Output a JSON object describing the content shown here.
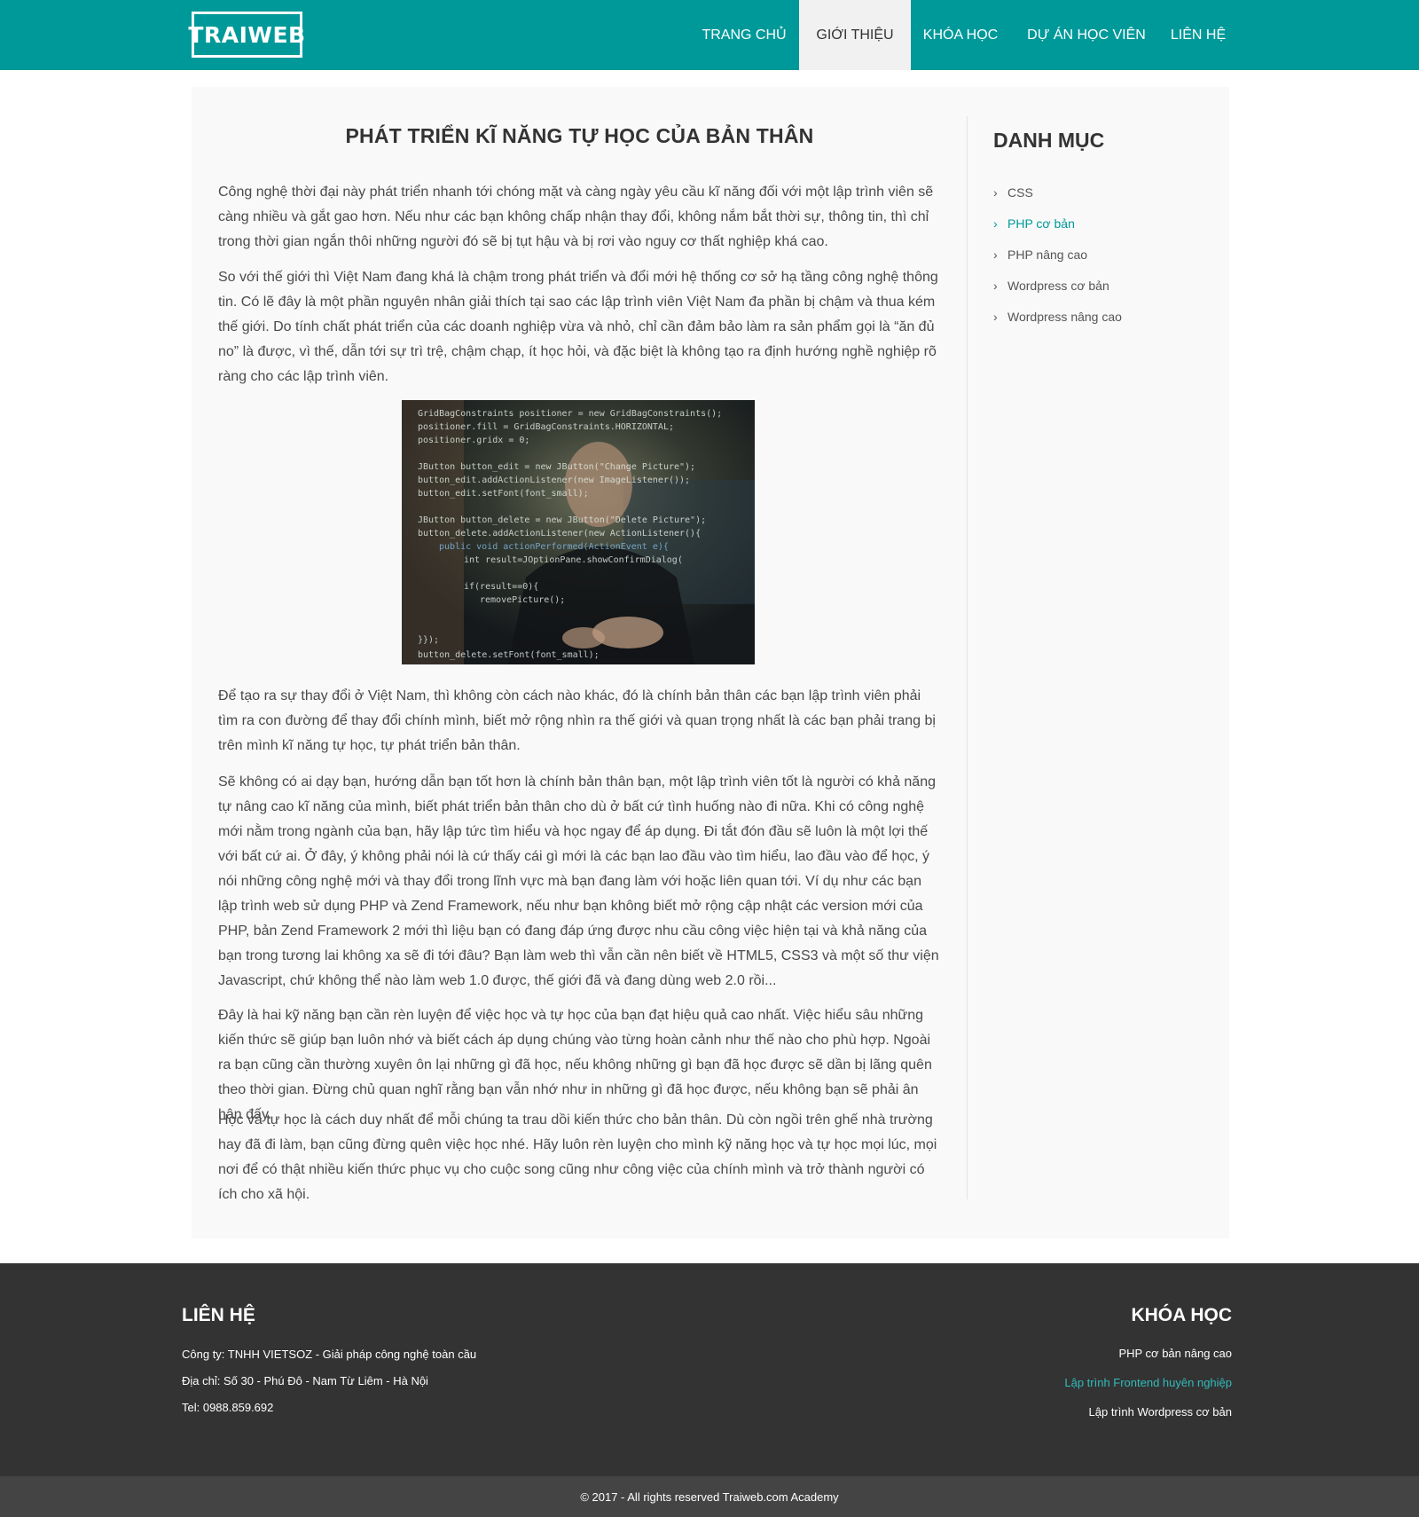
{
  "header": {
    "logo": "TRAIWEB",
    "nav": [
      {
        "label": "TRANG CHỦ"
      },
      {
        "label": "GIỚI THIỆU"
      },
      {
        "label": "KHÓA HỌC"
      },
      {
        "label": "DỰ ÁN HỌC VIÊN"
      },
      {
        "label": "LIÊN HỆ"
      }
    ]
  },
  "article": {
    "title": "PHÁT TRIỂN KĨ NĂNG TỰ HỌC CỦA BẢN THÂN",
    "paragraphs": [
      "Công nghệ thời đại này phát triển nhanh tới chóng mặt và càng ngày yêu cầu kĩ năng đối với một lập trình viên sẽ càng nhiều và gắt gao hơn. Nếu như các bạn không chấp nhận thay đổi, không nắm bắt thời sự, thông tin, thì chỉ trong thời gian ngắn thôi những người đó sẽ bị tụt hậu và bị rơi vào nguy cơ thất nghiệp khá cao.",
      "So với thế giới thì Việt Nam đang khá là chậm trong phát triển và đổi mới hệ thống cơ sở hạ tầng công nghệ thông tin. Có lẽ đây là một phần nguyên nhân giải thích tại sao các lập trình viên Việt Nam đa phần bị chậm và thua kém thế giới. Do tính chất phát triển của các doanh nghiệp vừa và nhỏ, chỉ cần đảm bảo làm ra sản phẩm gọi là “ăn đủ no” là được, vì thế, dẫn tới sự trì trệ, chậm chạp, ít học hỏi, và đặc biệt là không tạo ra định hướng nghề nghiệp rõ ràng cho các lập trình viên.",
      "Để tạo ra sự thay đổi ở Việt Nam, thì không còn cách nào khác, đó là chính bản thân các bạn lập trình viên phải tìm ra con đường để thay đổi chính mình, biết mở rộng nhìn ra thế giới và quan trọng nhất là các bạn phải trang bị trên mình kĩ năng tự học, tự phát triển bản thân.",
      "Sẽ không có ai dạy bạn, hướng dẫn bạn tốt hơn là chính bản thân bạn, một lập trình viên tốt là người có khả năng tự nâng cao kĩ năng của mình, biết phát triển bản thân cho dù ở bất cứ tình huống nào đi nữa. Khi có công nghệ mới nằm trong ngành của bạn, hãy lập tức tìm hiểu và học ngay để áp dụng. Đi tắt đón đầu sẽ luôn là một lợi thế với bất cứ ai. Ở đây, ý không phải nói là cứ thấy cái gì mới là các bạn lao đầu vào tìm hiểu, lao đầu vào để học, ý nói những công nghệ mới và thay đổi trong lĩnh vực mà bạn đang làm với hoặc liên quan tới. Ví dụ như các bạn lập trình web sử dụng PHP và Zend Framework, nếu như bạn không biết mở rộng cập nhật các version mới của PHP, bản Zend Framework 2 mới thì liệu bạn có đang đáp ứng được nhu cầu công việc hiện tại và khả năng của bạn trong tương lai không xa sẽ đi tới đâu? Bạn làm web thì vẫn cần nên biết về HTML5, CSS3 và một số thư viện Javascript, chứ không thể nào làm web 1.0 được, thế giới đã và đang dùng web 2.0 rồi...",
      "Đây là hai kỹ năng bạn cần rèn luyện để việc học và tự học của bạn đạt hiệu quả cao nhất. Việc hiểu sâu những kiến thức sẽ giúp bạn luôn nhớ và biết cách áp dụng chúng vào từng hoàn cảnh như thế nào cho phù hợp. Ngoài ra bạn cũng cần thường xuyên ôn lại những gì đã học, nếu không những gì bạn đã học được sẽ dần bị lãng quên theo thời gian. Đừng chủ quan nghĩ rằng bạn vẫn nhớ như in những gì đã học được, nếu không bạn sẽ phải ân hận đấy.",
      "Học và tự học là cách duy nhất để mỗi chúng ta trau dồi kiến thức cho bản thân. Dù còn ngồi trên ghế nhà trường hay đã đi làm, bạn cũng đừng quên việc học nhé. Hãy luôn rèn luyện cho mình kỹ năng học và tự học mọi lúc, mọi nơi để có thật nhiều kiến thức phục vụ cho cuộc song cũng như công việc của chính mình và trở thành người có ích cho xã hội."
    ],
    "image_code_lines": [
      "GridBagConstraints positioner = new GridBagConstraints();",
      "positioner.fill = GridBagConstraints.HORIZONTAL;",
      "positioner.gridx = 0;",
      "JButton button_edit = new JButton(\"Change Picture\");",
      "button_edit.addActionListener(new ImageListener());",
      "button_edit.setFont(font_small);",
      "JButton button_delete = new JButton(\"Delete Picture\");",
      "button_delete.addActionListener(new ActionListener(){",
      "public void actionPerformed(ActionEvent e){",
      "int result=JOptionPane.showConfirmDialog(",
      "if(result==0){",
      "removePicture();",
      "}});",
      "button_delete.setFont(font_small);"
    ]
  },
  "sidebar": {
    "title": "DANH MỤC",
    "items": [
      {
        "label": "CSS"
      },
      {
        "label": "PHP cơ bản"
      },
      {
        "label": "PHP nâng cao"
      },
      {
        "label": "Wordpress cơ bản"
      },
      {
        "label": "Wordpress nâng cao"
      }
    ]
  },
  "footer": {
    "contact_title": "LIÊN HỆ",
    "company": "Công ty: TNHH VIETSOZ - Giải pháp công nghệ toàn cầu",
    "address": "Địa chỉ: Số 30 - Phú Đô - Nam Từ Liêm - Hà Nội",
    "tel": "Tel: 0988.859.692",
    "courses_title": "KHÓA HỌC",
    "courses": [
      {
        "label": "PHP cơ bản nâng cao"
      },
      {
        "label": "Lập trình Frontend huyên nghiệp"
      },
      {
        "label": "Lập trình Wordpress cơ bản"
      }
    ],
    "copyright": "© 2017 - All rights reserved Traiweb.com Academy"
  },
  "colors": {
    "brand": "#009999",
    "footer_bg": "#333333",
    "footer_bottom_bg": "#444444",
    "active_link": "#33bbbb"
  }
}
